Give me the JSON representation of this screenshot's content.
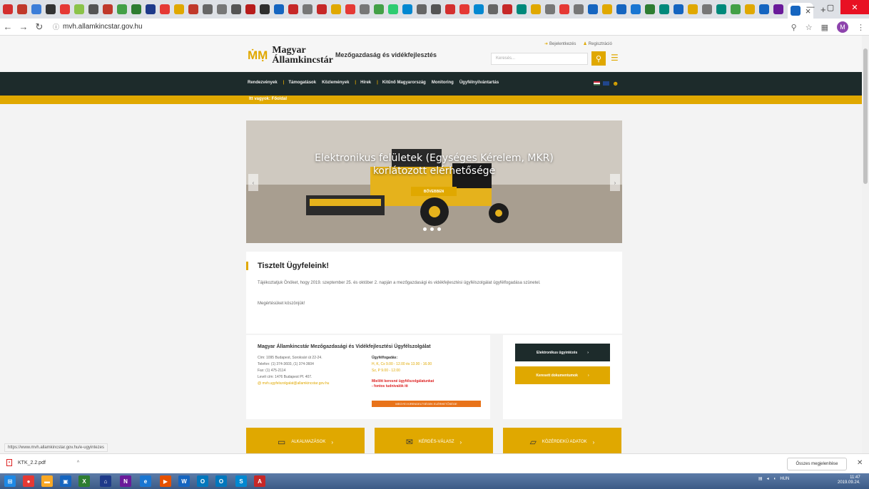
{
  "browser": {
    "address": "mvh.allamkincstar.gov.hu",
    "status_url": "https://www.mvh.allamkincstar.gov.hu/e-ugyintezes",
    "tab_close": "×",
    "new_tab": "+"
  },
  "header": {
    "logo_line1": "Magyar",
    "logo_line2": "Államkincstár",
    "tagline": "Mezőgazdaság és vidékfejlesztés",
    "login": "Bejelentkezés",
    "register": "Regisztráció",
    "search_placeholder": "Keresés..."
  },
  "nav": {
    "items": [
      "Rendezvények",
      "Támogatások",
      "Közlemények",
      "Hírek",
      "Kitűnő Magyarország",
      "Monitoring",
      "Ügyfélnyilvántartás"
    ],
    "sub": "Itt vagyok: Főoldal"
  },
  "hero": {
    "title_line1": "Elektronikus felületek (Egységes Kérelem, MKR)",
    "title_line2": "korlátozott elérhetősége",
    "button": "BŐVEBBEN"
  },
  "notice": {
    "title": "Tisztelt Ügyfeleink!",
    "text": "Tájékoztatjuk Önöket, hogy 2019. szeptember 25. és október 2. napján a mezőgazdasági és vidékfejlesztési ügyfélszolgálat ügyfélfogadása szünetel.",
    "thanks": "Megértésüket köszönjük!"
  },
  "contact": {
    "title": "Magyar Államkincstár Mezőgazdasági és Vidékfejlesztési Ügyfélszolgálat",
    "address": "Cím: 1095 Budapest, Soroksári út 22-24.",
    "phone": "Telefon: (1) 374-3603, (1) 374-3604",
    "fax": "Fax: (1) 475-2114",
    "mail": "Levél cím: 1476 Budapest Pf. 407.",
    "email": "mvh.ugyfelszolgalat@allamkincstar.gov.hu",
    "hours_title": "Ügyfélfogadás:",
    "hours1": "H, K, Cs 9.00 - 12.00 és 13.00 - 16.00",
    "hours2": "Sz, P 9.00 - 12.00",
    "red_note": "Mielőtt keresné ügyfélszolgálatunkat - fontos tudnivalók itt",
    "orange_btn": "MEGYEI KIRENDELTSÉGEK ELÉRHETŐSÉGE"
  },
  "side": {
    "btn1": "Elektronikus ügyintézés",
    "btn2": "Keresett dokumentumok"
  },
  "tiles": [
    "ALKALMAZÁSOK",
    "KÉRDÉS-VÁLASZ",
    "KÖZÉRDEKŰ ADATOK"
  ],
  "shelf": {
    "file": "KTK_2.2.pdf",
    "show_all": "Összes megjelenítése"
  },
  "taskbar": {
    "lang": "HUN",
    "time": "11:47",
    "date": "2019.09.24."
  },
  "colors": {
    "accent": "#e0a800",
    "nav_bg": "#1d2b2b",
    "alert": "#dd2222"
  }
}
